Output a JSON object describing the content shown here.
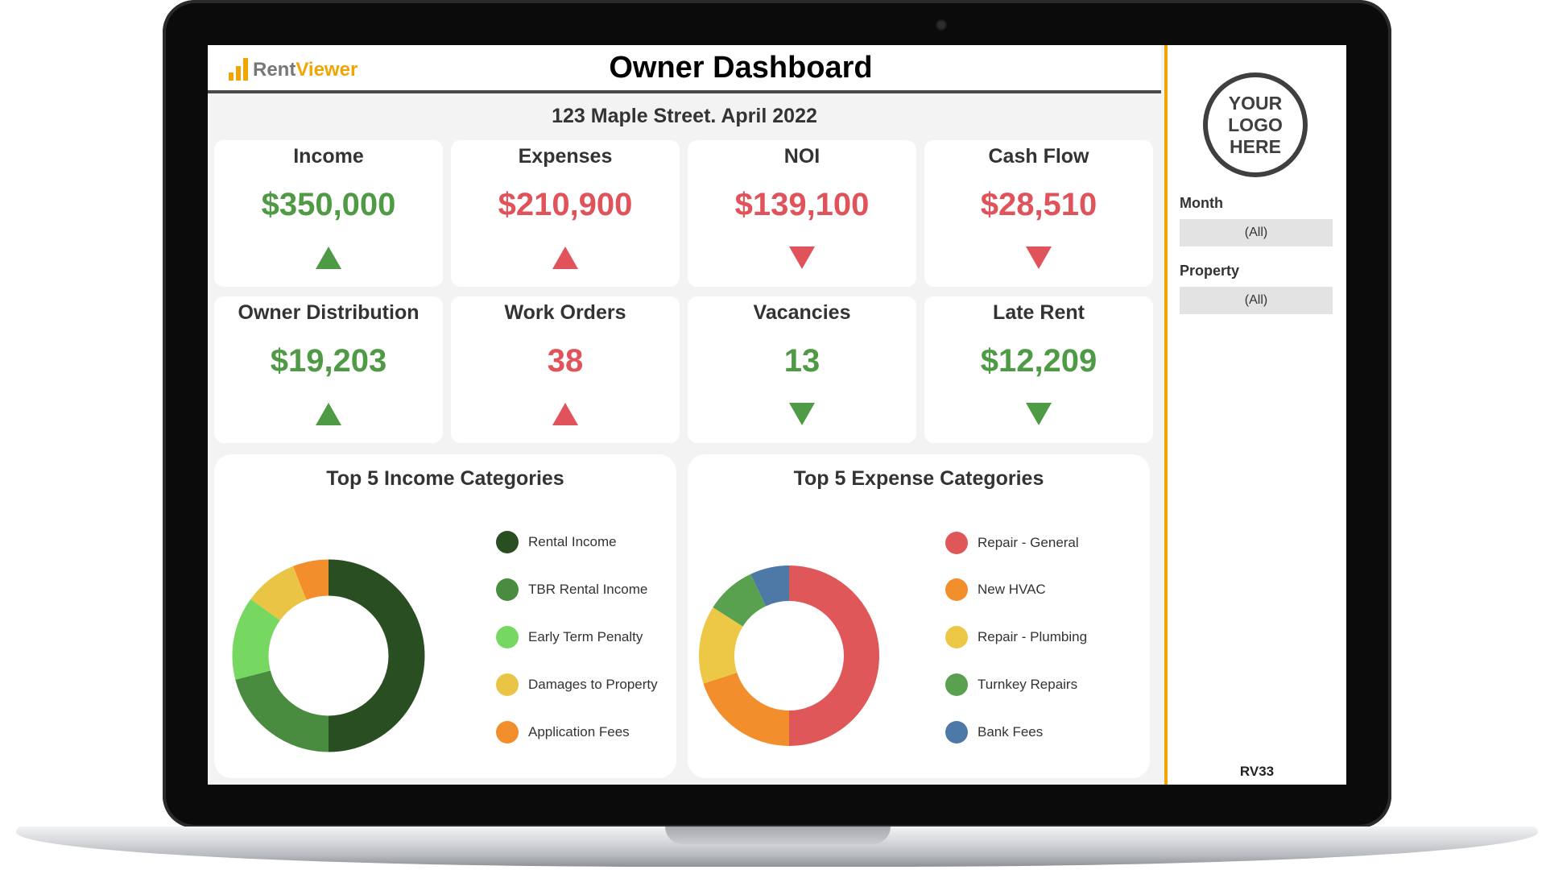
{
  "app": {
    "brand_part1": "Rent",
    "brand_part2": "Viewer",
    "title": "Owner Dashboard",
    "subtitle": "123 Maple Street. April 2022"
  },
  "colors": {
    "accent": "#f0a500",
    "positive": "#4f9a45",
    "negative": "#e0535a"
  },
  "kpis": [
    {
      "label": "Income",
      "value": "$350,000",
      "color": "green",
      "trend": "up"
    },
    {
      "label": "Expenses",
      "value": "$210,900",
      "color": "red",
      "trend": "up"
    },
    {
      "label": "NOI",
      "value": "$139,100",
      "color": "red",
      "trend": "down"
    },
    {
      "label": "Cash Flow",
      "value": "$28,510",
      "color": "red",
      "trend": "down"
    },
    {
      "label": "Owner Distribution",
      "value": "$19,203",
      "color": "green",
      "trend": "up"
    },
    {
      "label": "Work Orders",
      "value": "38",
      "color": "red",
      "trend": "up"
    },
    {
      "label": "Vacancies",
      "value": "13",
      "color": "green",
      "trend": "down"
    },
    {
      "label": "Late Rent",
      "value": "$12,209",
      "color": "green",
      "trend": "down"
    }
  ],
  "sidebar": {
    "logo_placeholder": "YOUR\nLOGO\nHERE",
    "filters": [
      {
        "label": "Month",
        "value": "(All)"
      },
      {
        "label": "Property",
        "value": "(All)"
      }
    ],
    "version": "RV33"
  },
  "chart_data": [
    {
      "type": "pie",
      "title": "Top 5 Income Categories",
      "categories": [
        "Rental Income",
        "TBR Rental Income",
        "Early Term Penalty",
        "Damages to Property",
        "Application Fees"
      ],
      "values": [
        50,
        21,
        14,
        9,
        6
      ],
      "colors": [
        "#284e22",
        "#4a8c3f",
        "#76d861",
        "#eac445",
        "#f28e2b"
      ]
    },
    {
      "type": "pie",
      "title": "Top 5 Expense Categories",
      "categories": [
        "Repair - General",
        "New HVAC",
        "Repair - Plumbing",
        "Turnkey Repairs",
        "Bank Fees"
      ],
      "values": [
        50,
        20,
        14,
        9,
        7
      ],
      "colors": [
        "#e05759",
        "#f28e2b",
        "#ecc846",
        "#59a14f",
        "#4e79a7"
      ]
    }
  ]
}
